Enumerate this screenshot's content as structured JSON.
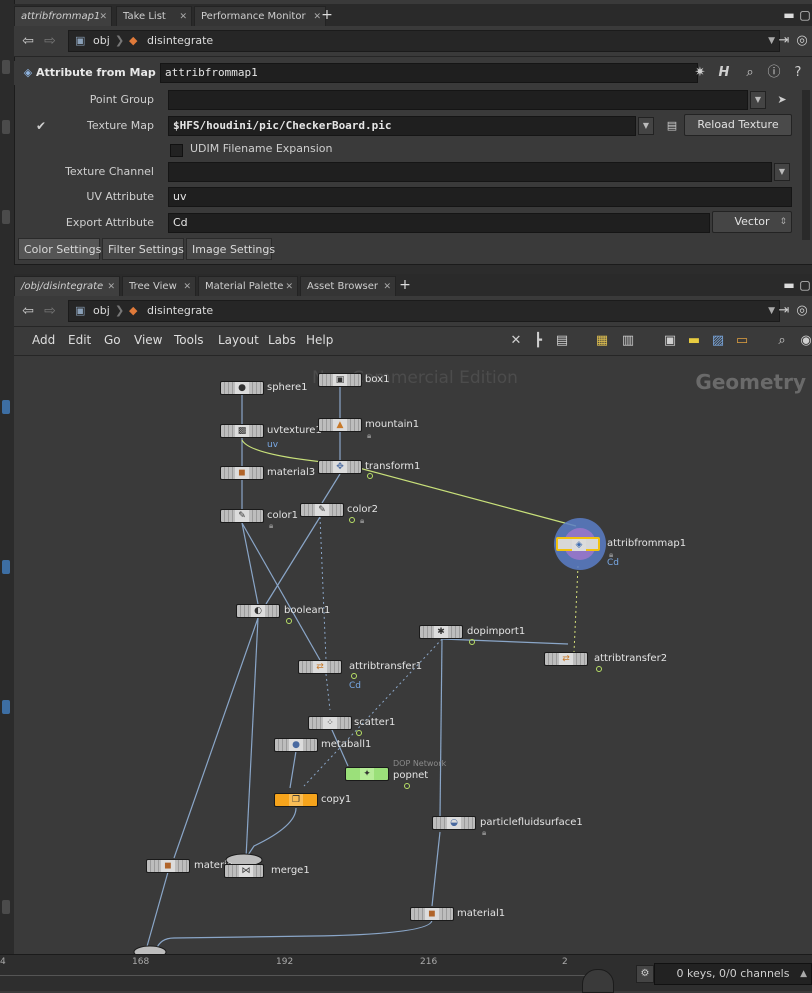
{
  "pane_top": {
    "tabs": [
      {
        "label": "attribfrommap1",
        "active": true
      },
      {
        "label": "Take List",
        "active": false
      },
      {
        "label": "Performance Monitor",
        "active": false
      }
    ],
    "path": {
      "root": "obj",
      "node": "disintegrate"
    }
  },
  "parameters": {
    "op_type": "Attribute from Map",
    "node_name": "attribfrommap1",
    "point_group": {
      "label": "Point Group",
      "value": ""
    },
    "texture_map": {
      "label": "Texture Map",
      "value": "$HFS/houdini/pic/CheckerBoard.pic",
      "enabled": true
    },
    "reload_button": "Reload Texture",
    "udim": {
      "label": "UDIM Filename Expansion",
      "checked": false
    },
    "texture_channel": {
      "label": "Texture Channel",
      "value": ""
    },
    "uv_attribute": {
      "label": "UV Attribute",
      "value": "uv"
    },
    "export_attribute": {
      "label": "Export Attribute",
      "value": "Cd",
      "type": "Vector"
    },
    "tabs": [
      "Color Settings",
      "Filter Settings",
      "Image Settings"
    ]
  },
  "pane_bottom": {
    "tabs": [
      {
        "label": "/obj/disintegrate",
        "active": true
      },
      {
        "label": "Tree View",
        "active": false
      },
      {
        "label": "Material Palette",
        "active": false
      },
      {
        "label": "Asset Browser",
        "active": false
      }
    ],
    "path": {
      "root": "obj",
      "node": "disintegrate"
    },
    "menu": [
      "Add",
      "Edit",
      "Go",
      "View",
      "Tools",
      "Layout",
      "Labs",
      "Help"
    ]
  },
  "network": {
    "watermark": "Non-Commercial Edition",
    "context": "Geometry",
    "nodes": [
      {
        "name": "sphere1"
      },
      {
        "name": "box1"
      },
      {
        "name": "uvtexture1",
        "attr": "uv"
      },
      {
        "name": "mountain1"
      },
      {
        "name": "material3"
      },
      {
        "name": "transform1"
      },
      {
        "name": "color1"
      },
      {
        "name": "color2"
      },
      {
        "name": "attribfrommap1",
        "attr": "Cd"
      },
      {
        "name": "boolean1"
      },
      {
        "name": "dopimport1"
      },
      {
        "name": "attribtransfer1",
        "attr": "Cd"
      },
      {
        "name": "attribtransfer2"
      },
      {
        "name": "scatter1"
      },
      {
        "name": "metaball1"
      },
      {
        "name": "popnet",
        "subtitle": "DOP Network"
      },
      {
        "name": "copy1"
      },
      {
        "name": "particlefluidsurface1"
      },
      {
        "name": "materia"
      },
      {
        "name": "merge1"
      },
      {
        "name": "material1"
      }
    ]
  },
  "timeline": {
    "ticks": [
      "4",
      "168",
      "192",
      "216",
      "2"
    ],
    "keys": "0 keys, 0/0 channels"
  },
  "colors": {
    "selected_node": "#f2c20e",
    "copy_node": "#f6a41c",
    "popnet_node": "#9be07a",
    "wire": "#8aa6c8",
    "highlight_wire": "#c8e07a"
  }
}
